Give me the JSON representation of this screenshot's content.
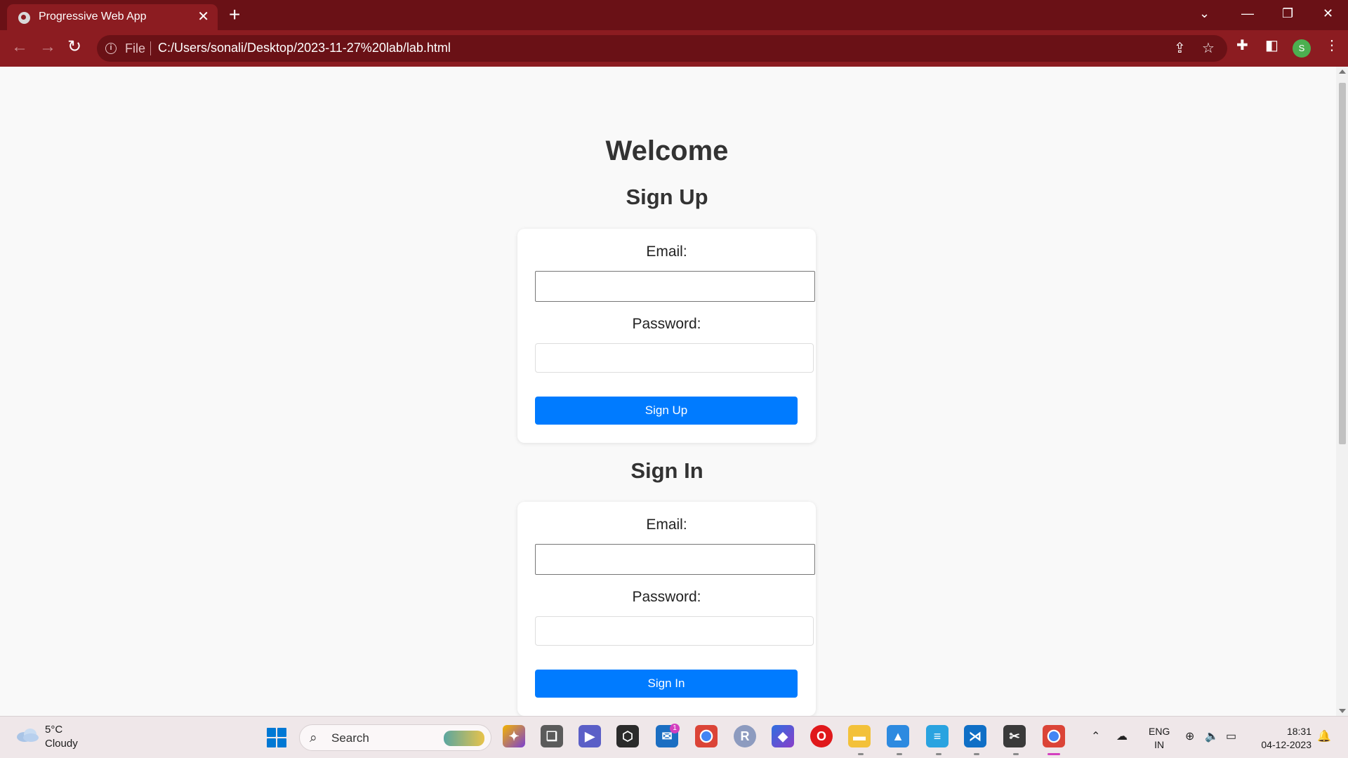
{
  "browser": {
    "tab_title": "Progressive Web App",
    "tab_close": "✕",
    "new_tab": "+",
    "url_scheme": "File",
    "url": "C:/Users/sonali/Desktop/2023-11-27%20lab/lab.html",
    "profile_initial": "S"
  },
  "page": {
    "welcome": "Welcome",
    "signup": {
      "heading": "Sign Up",
      "email_label": "Email:",
      "email_value": "",
      "password_label": "Password:",
      "password_value": "",
      "button": "Sign Up"
    },
    "signin": {
      "heading": "Sign In",
      "email_label": "Email:",
      "email_value": "",
      "password_label": "Password:",
      "password_value": "",
      "button": "Sign In"
    }
  },
  "taskbar": {
    "weather_temp": "5°C",
    "weather_cond": "Cloudy",
    "search_label": "Search",
    "mail_badge": "1",
    "lang_1": "ENG",
    "lang_2": "IN",
    "time": "18:31",
    "date": "04-12-2023"
  },
  "colors": {
    "browser_frame": "#6a1116",
    "browser_toolbar": "#8c1c21",
    "primary_button": "#007bff",
    "page_background": "#f9f9f9"
  }
}
